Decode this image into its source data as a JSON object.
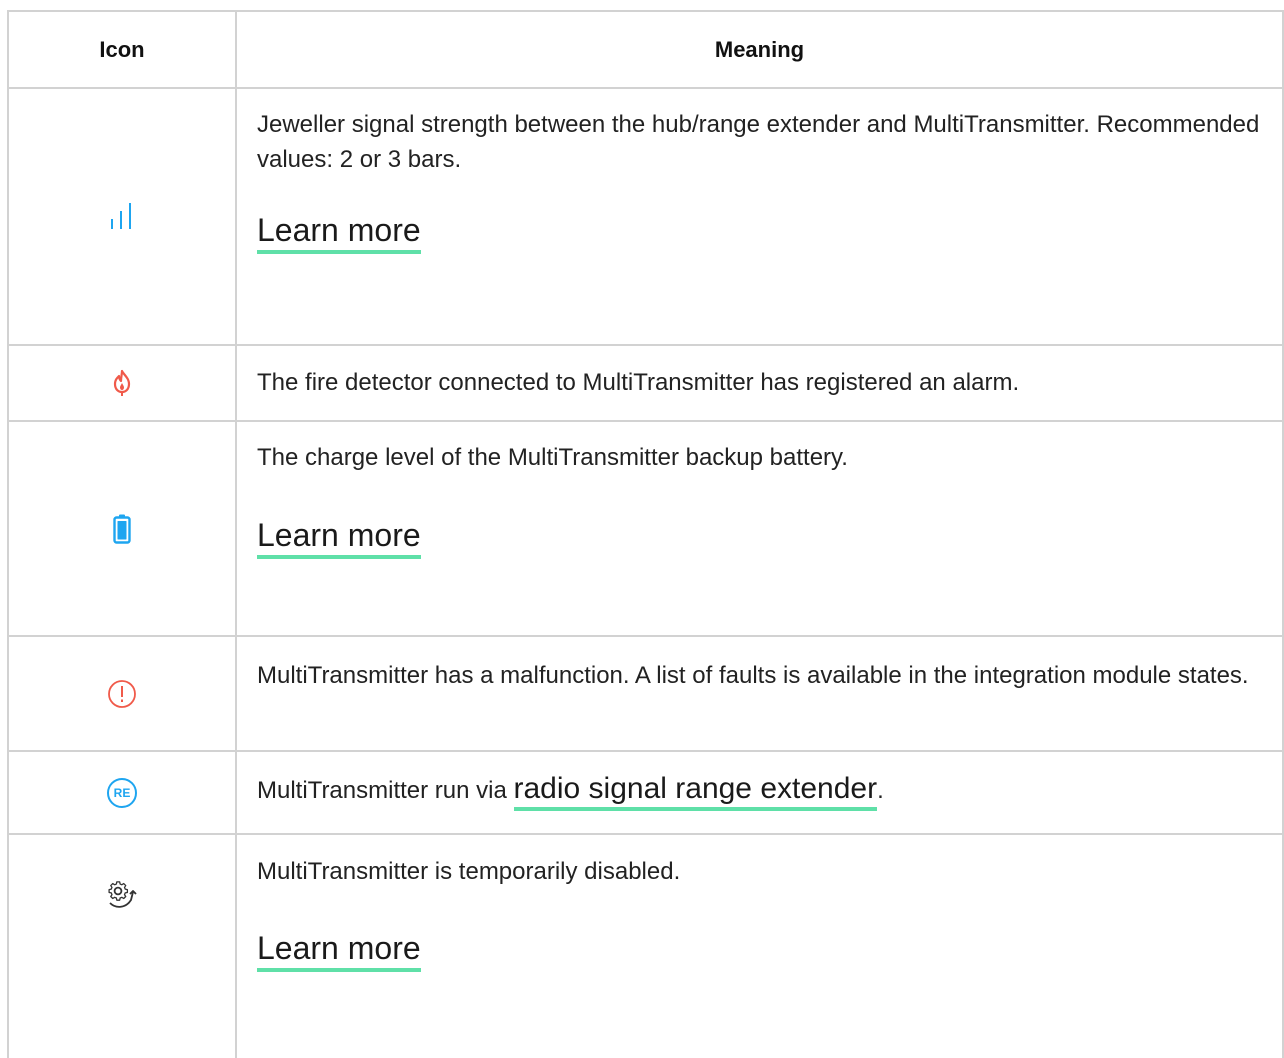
{
  "header": {
    "icon_label": "Icon",
    "meaning_label": "Meaning"
  },
  "colors": {
    "link_underline": "#5fe0a8",
    "icon_blue": "#1ea5f0",
    "icon_red": "#f05a4a",
    "grid": "#d2d2d2"
  },
  "rows": [
    {
      "icon": "signal-strength-icon",
      "text": "Jeweller signal strength between the hub/range extender and MultiTransmitter. Recommended values: 2 or 3 bars.",
      "link": "Learn more"
    },
    {
      "icon": "fire-alarm-icon",
      "text": "The fire detector connected to MultiTransmitter has registered an alarm."
    },
    {
      "icon": "battery-icon",
      "text": "The charge level of the MultiTransmitter backup battery.",
      "link": "Learn more"
    },
    {
      "icon": "malfunction-icon",
      "text": "MultiTransmitter has a malfunction. A list of faults is available in the integration module states."
    },
    {
      "icon": "range-extender-icon",
      "icon_text": "RE",
      "text_before": "MultiTransmitter run via ",
      "link": "radio signal range extender",
      "text_after": "."
    },
    {
      "icon": "temporarily-disabled-icon",
      "text": "MultiTransmitter is temporarily disabled.",
      "link": "Learn more"
    }
  ]
}
